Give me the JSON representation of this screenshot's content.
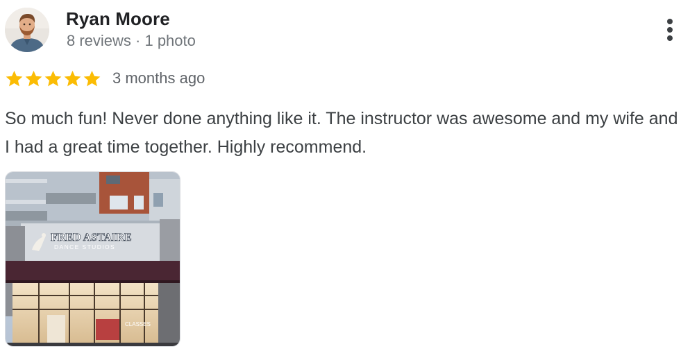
{
  "reviewer": {
    "name": "Ryan Moore",
    "meta": "8 reviews · 1 photo",
    "avatar_icon": "user-avatar"
  },
  "more_menu": {
    "icon": "more-vertical-icon"
  },
  "rating": {
    "stars": 5,
    "max_stars": 5,
    "star_color": "#fbbc04",
    "time": "3 months ago"
  },
  "review": {
    "text": "So much fun! Never done anything like it. The instructor was awesome and my wife and I had a great time together. Highly recommend."
  },
  "photo": {
    "sign_line1": "FRED ASTAIRE",
    "sign_line2": "DANCE STUDIOS",
    "window_text": "CLASSES"
  }
}
